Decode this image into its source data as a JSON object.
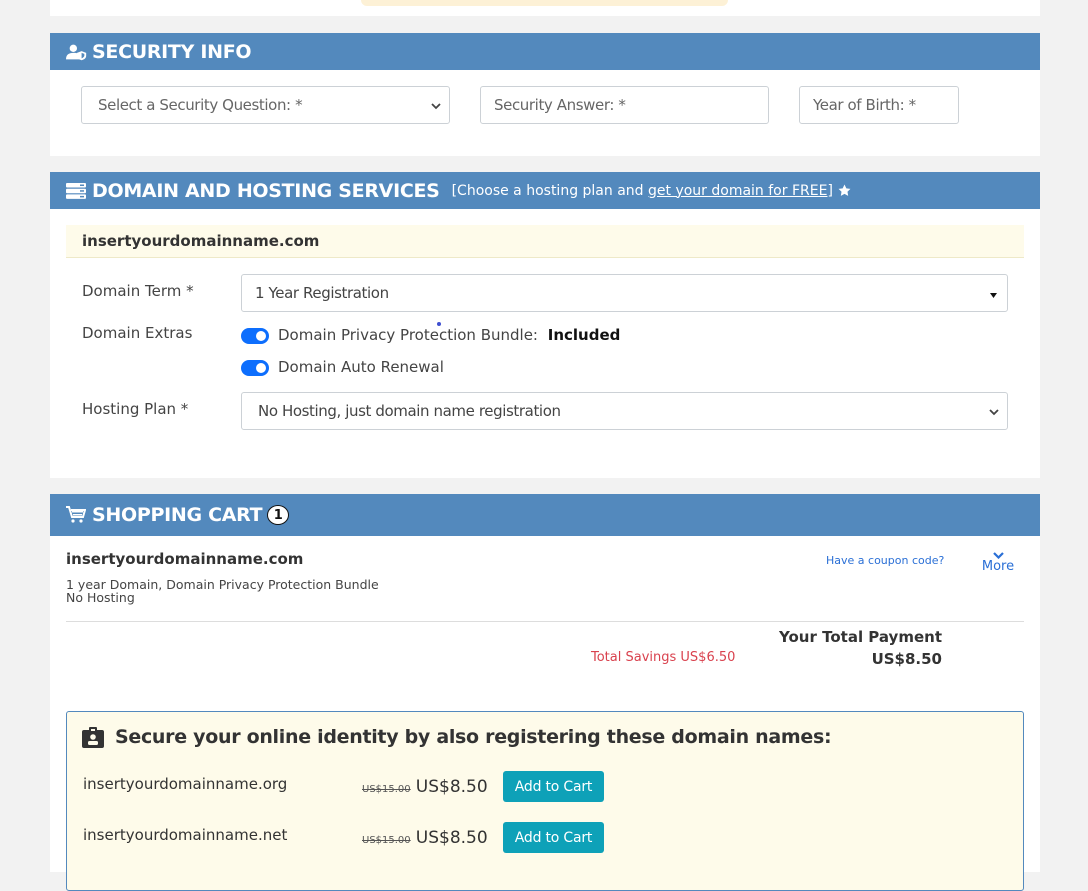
{
  "security": {
    "title": "SECURITY INFO",
    "question_placeholder": "Select a Security Question: *",
    "answer_placeholder": "Security Answer: *",
    "birth_year_placeholder": "Year of Birth: *"
  },
  "domain_hosting": {
    "title": "DOMAIN AND HOSTING SERVICES",
    "subtitle_prefix": "[Choose a hosting plan and ",
    "subtitle_link": "get your domain for FREE",
    "subtitle_suffix": "]",
    "domain_name": "insertyourdomainname.com",
    "term_label": "Domain Term *",
    "term_value": "1 Year Registration",
    "extras_label": "Domain Extras",
    "privacy_label": "Domain Privacy Protection Bundle:",
    "privacy_status": "Included",
    "privacy_enabled": true,
    "auto_renew_label": "Domain Auto Renewal",
    "auto_renew_enabled": true,
    "hosting_label": "Hosting Plan *",
    "hosting_value": "No Hosting, just domain name registration"
  },
  "cart": {
    "title": "SHOPPING CART",
    "count": "1",
    "item_name": "insertyourdomainname.com",
    "item_desc_line1": "1 year Domain, Domain Privacy Protection Bundle",
    "item_desc_line2": "No Hosting",
    "coupon_link": "Have a coupon code?",
    "more_label": "More",
    "savings": "Total Savings US$6.50",
    "total_label": "Your Total Payment",
    "total_value": "US$8.50"
  },
  "upsell": {
    "title": "Secure your online identity by also registering these domain names:",
    "items": [
      {
        "domain": "insertyourdomainname.org",
        "old_price": "US$15.00",
        "price": "US$8.50",
        "button": "Add to Cart"
      },
      {
        "domain": "insertyourdomainname.net",
        "old_price": "US$15.00",
        "price": "US$8.50",
        "button": "Add to Cart"
      }
    ]
  },
  "colors": {
    "header": "#5389bd",
    "accent_button": "#0ea1b8",
    "toggle": "#0d6efd",
    "savings_text": "#d9424e",
    "link": "#2a6fd6"
  }
}
